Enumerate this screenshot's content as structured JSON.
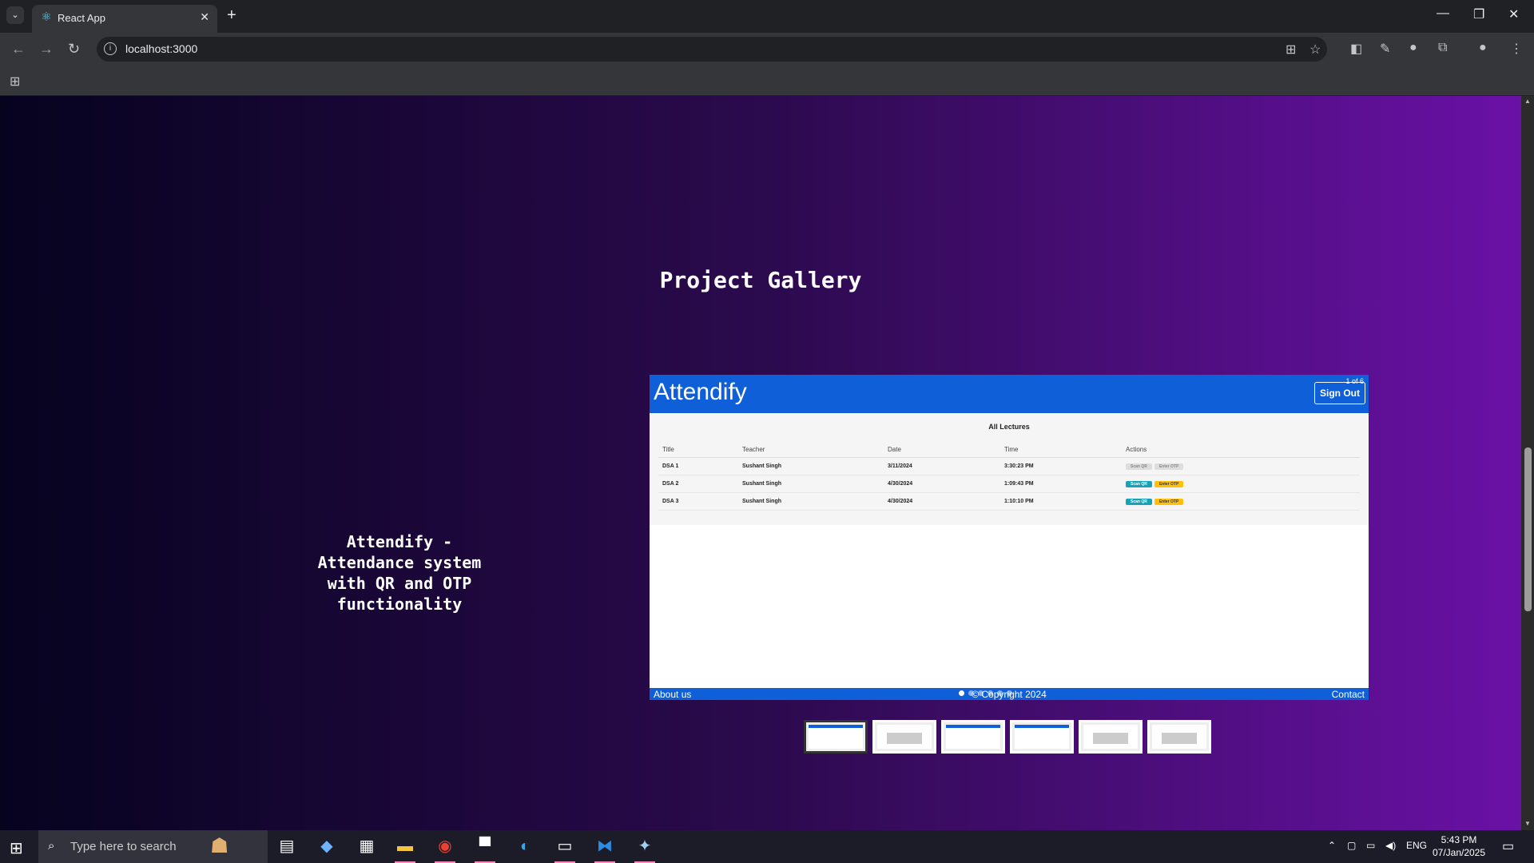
{
  "browser": {
    "tab_title": "React App",
    "url": "localhost:3000"
  },
  "page": {
    "gallery_title": "Project Gallery",
    "project_description": "Attendify - Attendance system with QR and OTP functionality",
    "slide": {
      "brand": "Attendify",
      "counter": "1 of 6",
      "signout_label": "Sign Out",
      "subtitle": "All Lectures",
      "table": {
        "headers": [
          "Title",
          "Teacher",
          "Date",
          "Time",
          "Actions"
        ],
        "rows": [
          [
            "DSA 1",
            "Sushant Singh",
            "3/11/2024",
            "3:30:23 PM"
          ],
          [
            "DSA 2",
            "Sushant Singh",
            "4/30/2024",
            "1:09:43 PM"
          ],
          [
            "DSA 3",
            "Sushant Singh",
            "4/30/2024",
            "1:10:10 PM"
          ]
        ],
        "action_labels": [
          "Scan QR",
          "Enter OTP"
        ]
      },
      "footer_left": "About us",
      "footer_mid": "© Copyright 2024",
      "footer_right": "Contact"
    },
    "slide_count": 6,
    "active_slide": 1
  },
  "taskbar": {
    "search_placeholder": "Type here to search",
    "lang": "ENG",
    "time": "5:43 PM",
    "date": "07/Jan/2025"
  },
  "colors": {
    "slide_header": "#0f5fd9",
    "gradient_left": "#06031f",
    "gradient_right": "#6a11a6"
  }
}
